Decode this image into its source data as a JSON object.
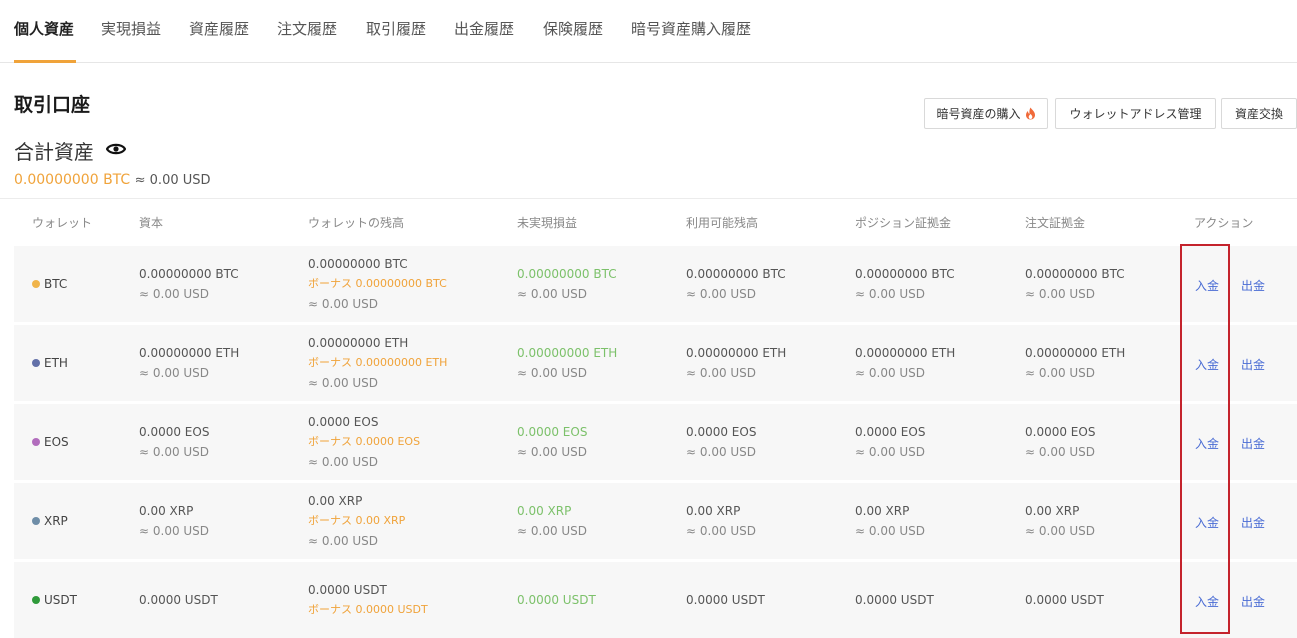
{
  "tabs": [
    "個人資産",
    "実現損益",
    "資産履歴",
    "注文履歴",
    "取引履歴",
    "出金履歴",
    "保険履歴",
    "暗号資産購入履歴"
  ],
  "section_title": "取引口座",
  "total": {
    "label": "合計資産",
    "btc": "0.00000000 BTC",
    "usd": "≈ 0.00 USD"
  },
  "buttons": {
    "buy_crypto": "暗号資産の購入",
    "wallet_address": "ウォレットアドレス管理",
    "asset_exchange": "資産交換"
  },
  "columns": [
    "ウォレット",
    "資本",
    "ウォレットの残高",
    "未実現損益",
    "利用可能残高",
    "ポジション証拠金",
    "注文証拠金",
    "アクション"
  ],
  "colors": {
    "accent": "#f0a33a",
    "link": "#4a6cd4",
    "profit": "#7cc16a",
    "highlight": "#c4232c"
  },
  "rows": [
    {
      "coin": "BTC",
      "dot_color": "#f0b44a",
      "capital": "0.00000000 BTC",
      "capital_usd": "≈ 0.00 USD",
      "balance": "0.00000000 BTC",
      "bonus": "ボーナス 0.00000000 BTC",
      "balance_usd": "≈ 0.00 USD",
      "pnl": "0.00000000 BTC",
      "pnl_usd": "≈ 0.00 USD",
      "available": "0.00000000 BTC",
      "available_usd": "≈ 0.00 USD",
      "position_margin": "0.00000000 BTC",
      "position_margin_usd": "≈ 0.00 USD",
      "order_margin": "0.00000000 BTC",
      "order_margin_usd": "≈ 0.00 USD",
      "deposit": "入金",
      "withdraw": "出金"
    },
    {
      "coin": "ETH",
      "dot_color": "#6270a8",
      "capital": "0.00000000 ETH",
      "capital_usd": "≈ 0.00 USD",
      "balance": "0.00000000 ETH",
      "bonus": "ボーナス 0.00000000 ETH",
      "balance_usd": "≈ 0.00 USD",
      "pnl": "0.00000000 ETH",
      "pnl_usd": "≈ 0.00 USD",
      "available": "0.00000000 ETH",
      "available_usd": "≈ 0.00 USD",
      "position_margin": "0.00000000 ETH",
      "position_margin_usd": "≈ 0.00 USD",
      "order_margin": "0.00000000 ETH",
      "order_margin_usd": "≈ 0.00 USD",
      "deposit": "入金",
      "withdraw": "出金"
    },
    {
      "coin": "EOS",
      "dot_color": "#b26dbd",
      "capital": "0.0000 EOS",
      "capital_usd": "≈ 0.00 USD",
      "balance": "0.0000 EOS",
      "bonus": "ボーナス 0.0000 EOS",
      "balance_usd": "≈ 0.00 USD",
      "pnl": "0.0000 EOS",
      "pnl_usd": "≈ 0.00 USD",
      "available": "0.0000 EOS",
      "available_usd": "≈ 0.00 USD",
      "position_margin": "0.0000 EOS",
      "position_margin_usd": "≈ 0.00 USD",
      "order_margin": "0.0000 EOS",
      "order_margin_usd": "≈ 0.00 USD",
      "deposit": "入金",
      "withdraw": "出金"
    },
    {
      "coin": "XRP",
      "dot_color": "#6f8ea8",
      "capital": "0.00 XRP",
      "capital_usd": "≈ 0.00 USD",
      "balance": "0.00 XRP",
      "bonus": "ボーナス 0.00 XRP",
      "balance_usd": "≈ 0.00 USD",
      "pnl": "0.00 XRP",
      "pnl_usd": "≈ 0.00 USD",
      "available": "0.00 XRP",
      "available_usd": "≈ 0.00 USD",
      "position_margin": "0.00 XRP",
      "position_margin_usd": "≈ 0.00 USD",
      "order_margin": "0.00 XRP",
      "order_margin_usd": "≈ 0.00 USD",
      "deposit": "入金",
      "withdraw": "出金"
    },
    {
      "coin": "USDT",
      "dot_color": "#2f9a3a",
      "capital": "0.0000 USDT",
      "balance": "0.0000 USDT",
      "bonus": "ボーナス 0.0000 USDT",
      "pnl": "0.0000 USDT",
      "available": "0.0000 USDT",
      "position_margin": "0.0000 USDT",
      "order_margin": "0.0000 USDT",
      "deposit": "入金",
      "withdraw": "出金"
    }
  ]
}
